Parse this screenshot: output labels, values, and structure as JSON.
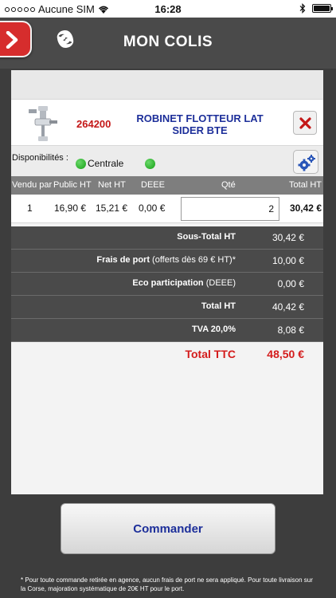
{
  "status_bar": {
    "carrier": "Aucune SIM",
    "time": "16:28"
  },
  "header": {
    "title": "MON COLIS",
    "menu_icon": "chevron-right-icon",
    "logo_icon": "swirl-logo-icon"
  },
  "product": {
    "reference": "264200",
    "name": "ROBINET FLOTTEUR LAT SIDER BTE",
    "image_icon": "float-valve-image",
    "delete_icon": "close-x-icon"
  },
  "availability": {
    "label": "Disponibilités :",
    "location": "Centrale",
    "settings_icon": "gears-icon"
  },
  "table": {
    "headers": [
      "Vendu par",
      "Public HT",
      "Net HT",
      "DEEE",
      "Qté",
      "Total HT"
    ],
    "row": {
      "vendu_par": "1",
      "public_ht": "16,90 €",
      "net_ht": "15,21 €",
      "deee": "0,00 €",
      "qte": "2",
      "total_ht": "30,42 €"
    }
  },
  "totals": {
    "sous_total_label": "Sous-Total HT",
    "sous_total": "30,42 €",
    "frais_label": "Frais de port",
    "frais_note": "(offerts dès 69 € HT)*",
    "frais": "10,00 €",
    "eco_label": "Eco participation",
    "eco_note": "(DEEE)",
    "eco": "0,00 €",
    "total_ht_label": "Total HT",
    "total_ht": "40,42 €",
    "tva_label": "TVA 20,0%",
    "tva": "8,08 €",
    "ttc_label": "Total TTC",
    "ttc": "48,50 €"
  },
  "actions": {
    "order_label": "Commander"
  },
  "footnote": "* Pour toute commande retirée en agence, aucun frais de port ne sera appliqué. Pour toute livraison sur la Corse, majoration systématique de 20€ HT pour le port.",
  "colors": {
    "accent_red": "#d41c1c",
    "link_blue": "#1d2f9a",
    "dark_bar": "#4a4a4a",
    "available_green": "#14a014"
  }
}
